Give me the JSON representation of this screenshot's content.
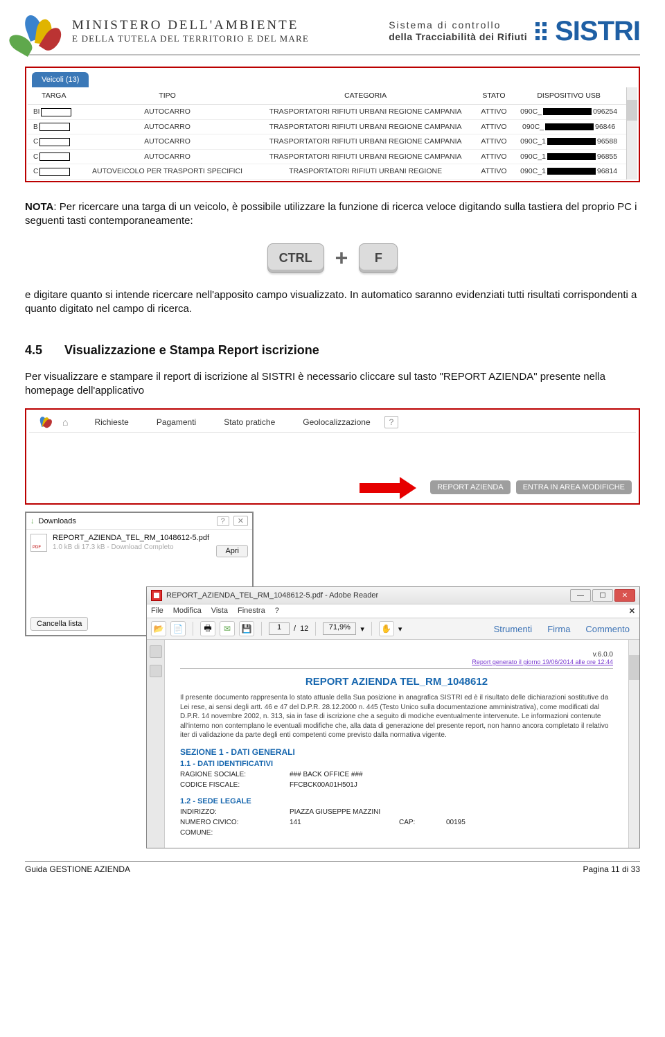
{
  "header": {
    "ministry_line1": "MINISTERO DELL'AMBIENTE",
    "ministry_line2": "E DELLA TUTELA DEL TERRITORIO E DEL MARE",
    "tag_line1": "Sistema di controllo",
    "tag_line2": "della Tracciabilità dei Rifiuti",
    "logo_text": "SISTRI"
  },
  "veicoli": {
    "tab_label": "Veicoli (13)",
    "cols": {
      "targa": "TARGA",
      "tipo": "TIPO",
      "categoria": "CATEGORIA",
      "stato": "STATO",
      "usb": "DISPOSITIVO USB"
    },
    "rows": [
      {
        "targa_prefix": "BI",
        "tipo": "AUTOCARRO",
        "categoria": "TRASPORTATORI RIFIUTI URBANI REGIONE CAMPANIA",
        "stato": "ATTIVO",
        "usb_prefix": "090C_",
        "usb_suffix": "096254"
      },
      {
        "targa_prefix": "B",
        "tipo": "AUTOCARRO",
        "categoria": "TRASPORTATORI RIFIUTI URBANI REGIONE CAMPANIA",
        "stato": "ATTIVO",
        "usb_prefix": "090C_",
        "usb_suffix": "96846"
      },
      {
        "targa_prefix": "C",
        "tipo": "AUTOCARRO",
        "categoria": "TRASPORTATORI RIFIUTI URBANI REGIONE CAMPANIA",
        "stato": "ATTIVO",
        "usb_prefix": "090C_1",
        "usb_suffix": "96588"
      },
      {
        "targa_prefix": "C",
        "tipo": "AUTOCARRO",
        "categoria": "TRASPORTATORI RIFIUTI URBANI REGIONE CAMPANIA",
        "stato": "ATTIVO",
        "usb_prefix": "090C_1",
        "usb_suffix": "96855"
      },
      {
        "targa_prefix": "C",
        "tipo": "AUTOVEICOLO PER TRASPORTI SPECIFICI",
        "categoria": "TRASPORTATORI RIFIUTI URBANI REGIONE",
        "stato": "ATTIVO",
        "usb_prefix": "090C_1",
        "usb_suffix": "96814"
      }
    ]
  },
  "text": {
    "nota_label": "NOTA",
    "nota_body": ": Per ricercare una targa di un veicolo, è possibile utilizzare la funzione di ricerca veloce digitando sulla tastiera del proprio PC i seguenti tasti contemporaneamente:",
    "key_ctrl": "CTRL",
    "key_plus": "+",
    "key_f": "F",
    "after_keys": "e digitare quanto si intende ricercare nell'apposito campo visualizzato. In automatico saranno evidenziati tutti risultati corrispondenti a quanto digitato nel campo di ricerca.",
    "sec_num": "4.5",
    "sec_title": "Visualizzazione e Stampa Report iscrizione",
    "sec_body": "Per visualizzare e stampare il report di iscrizione al SISTRI è necessario cliccare sul tasto \"REPORT AZIENDA\" presente nella homepage dell'applicativo"
  },
  "menubar": {
    "items": [
      "Richieste",
      "Pagamenti",
      "Stato pratiche",
      "Geolocalizzazione"
    ],
    "help": "?",
    "btn_report": "REPORT AZIENDA",
    "btn_modifiche": "ENTRA IN AREA MODIFICHE"
  },
  "downloads": {
    "title": "Downloads",
    "help": "?",
    "close": "✕",
    "filename": "REPORT_AZIENDA_TEL_RM_1048612-5.pdf",
    "apri": "Apri",
    "status": "1.0 kB di 17.3 kB - Download Completo",
    "cancel": "Cancella lista"
  },
  "adobe": {
    "title": "REPORT_AZIENDA_TEL_RM_1048612-5.pdf - Adobe Reader",
    "menu": [
      "File",
      "Modifica",
      "Vista",
      "Finestra",
      "?"
    ],
    "page_current": "1",
    "page_sep": "/",
    "page_total": "12",
    "zoom": "71,9%",
    "tab_tools": "Strumenti",
    "tab_sign": "Firma",
    "tab_comment": "Commento",
    "doc": {
      "version": "v.6.0.0",
      "generated": "Report generato il giorno 19/06/2014 alle ore 12:44",
      "title": "REPORT AZIENDA TEL_RM_1048612",
      "body": "Il presente documento rappresenta lo stato attuale della Sua posizione in anagrafica SISTRI ed è il risultato delle dichiarazioni sostitutive da Lei rese, ai sensi degli artt. 46 e 47 del D.P.R. 28.12.2000 n. 445 (Testo Unico sulla documentazione amministrativa), come modificati dal D.P.R. 14 novembre 2002, n. 313, sia in fase di iscrizione che a seguito di modiche eventualmente intervenute. Le informazioni contenute all'interno non contemplano le eventuali modifiche che, alla data di generazione del presente report, non hanno ancora completato il relativo iter di validazione da parte degli enti competenti come previsto dalla normativa vigente.",
      "sect1": "SEZIONE 1 - DATI GENERALI",
      "sub11": "1.1 - DATI IDENTIFICATIVI",
      "ragione_k": "RAGIONE SOCIALE:",
      "ragione_v": "### BACK OFFICE ###",
      "cf_k": "CODICE FISCALE:",
      "cf_v": "FFCBCK00A01H501J",
      "sub12": "1.2 - SEDE LEGALE",
      "ind_k": "INDIRIZZO:",
      "ind_v": "PIAZZA GIUSEPPE MAZZINI",
      "num_k": "NUMERO CIVICO:",
      "num_v": "141",
      "cap_k": "CAP:",
      "cap_v": "00195",
      "com_k": "COMUNE:"
    }
  },
  "footer": {
    "left": "Guida GESTIONE AZIENDA",
    "right": "Pagina 11 di 33"
  }
}
